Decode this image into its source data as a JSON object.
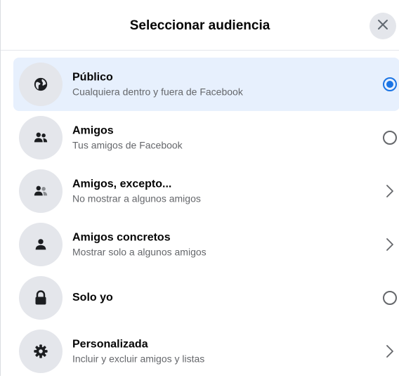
{
  "header": {
    "title": "Seleccionar audiencia",
    "close_icon": "close-icon"
  },
  "options": [
    {
      "title": "Público",
      "description": "Cualquiera dentro y fuera de Facebook",
      "icon": "globe-icon",
      "control": "radio",
      "selected": true
    },
    {
      "title": "Amigos",
      "description": "Tus amigos de Facebook",
      "icon": "friends-icon",
      "control": "radio",
      "selected": false
    },
    {
      "title": "Amigos, excepto...",
      "description": "No mostrar a algunos amigos",
      "icon": "friends-except-icon",
      "control": "chevron",
      "selected": false
    },
    {
      "title": "Amigos concretos",
      "description": "Mostrar solo a algunos amigos",
      "icon": "person-icon",
      "control": "chevron",
      "selected": false
    },
    {
      "title": "Solo yo",
      "description": "",
      "icon": "lock-icon",
      "control": "radio",
      "selected": false
    },
    {
      "title": "Personalizada",
      "description": "Incluir y excluir amigos y listas",
      "icon": "gear-icon",
      "control": "chevron",
      "selected": false
    }
  ],
  "colors": {
    "accent": "#1b74e4",
    "selected_bg": "#e7f0fd",
    "icon_bg": "#e4e6eb",
    "secondary_text": "#65676b"
  }
}
